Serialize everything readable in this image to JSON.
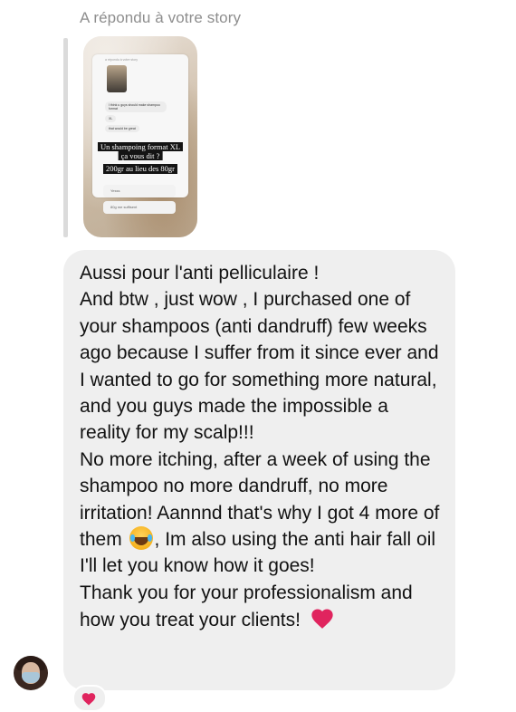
{
  "reply_header": "A répondu à votre story",
  "story": {
    "mini_header": "a répondu à votre story",
    "mini_bubble_1": "I think u guys should make shampoo format",
    "mini_bubble_2": "XL",
    "mini_bubble_3": "that would be great",
    "overlay_line_1": "Un shampoing format XL",
    "overlay_line_2": "ça vous dit ?",
    "overlay_line_3": "200gr au lieu des 80gr",
    "poll_option_1": "Yesss",
    "poll_option_2": "80g me suffisent"
  },
  "message": {
    "paragraph_1": "Aussi pour l'anti pelliculaire !",
    "paragraph_2": "And btw , just wow , I purchased one of your shampoos (anti dandruff) few weeks ago because I suffer from it since ever and I wanted to go for something more natural, and you guys made the impossible a reality for my scalp!!!",
    "paragraph_3_part_1": "No more itching, after a week of using the shampoo no more dandruff, no more irritation! Aannnd that's why I got 4 more of them",
    "paragraph_3_part_2": ", Im also using the anti hair fall oil I'll let you know how it goes!",
    "paragraph_4": "Thank you for your professionalism and how you treat your clients!"
  },
  "icons": {
    "laugh_emoji": "face-with-tears-of-joy-icon",
    "heart_emoji": "red-heart-icon",
    "reaction": "red-heart-reaction-icon"
  },
  "colors": {
    "bubble": "#efefef",
    "header_text": "#8e8e8e",
    "heart": "#e0245e"
  }
}
